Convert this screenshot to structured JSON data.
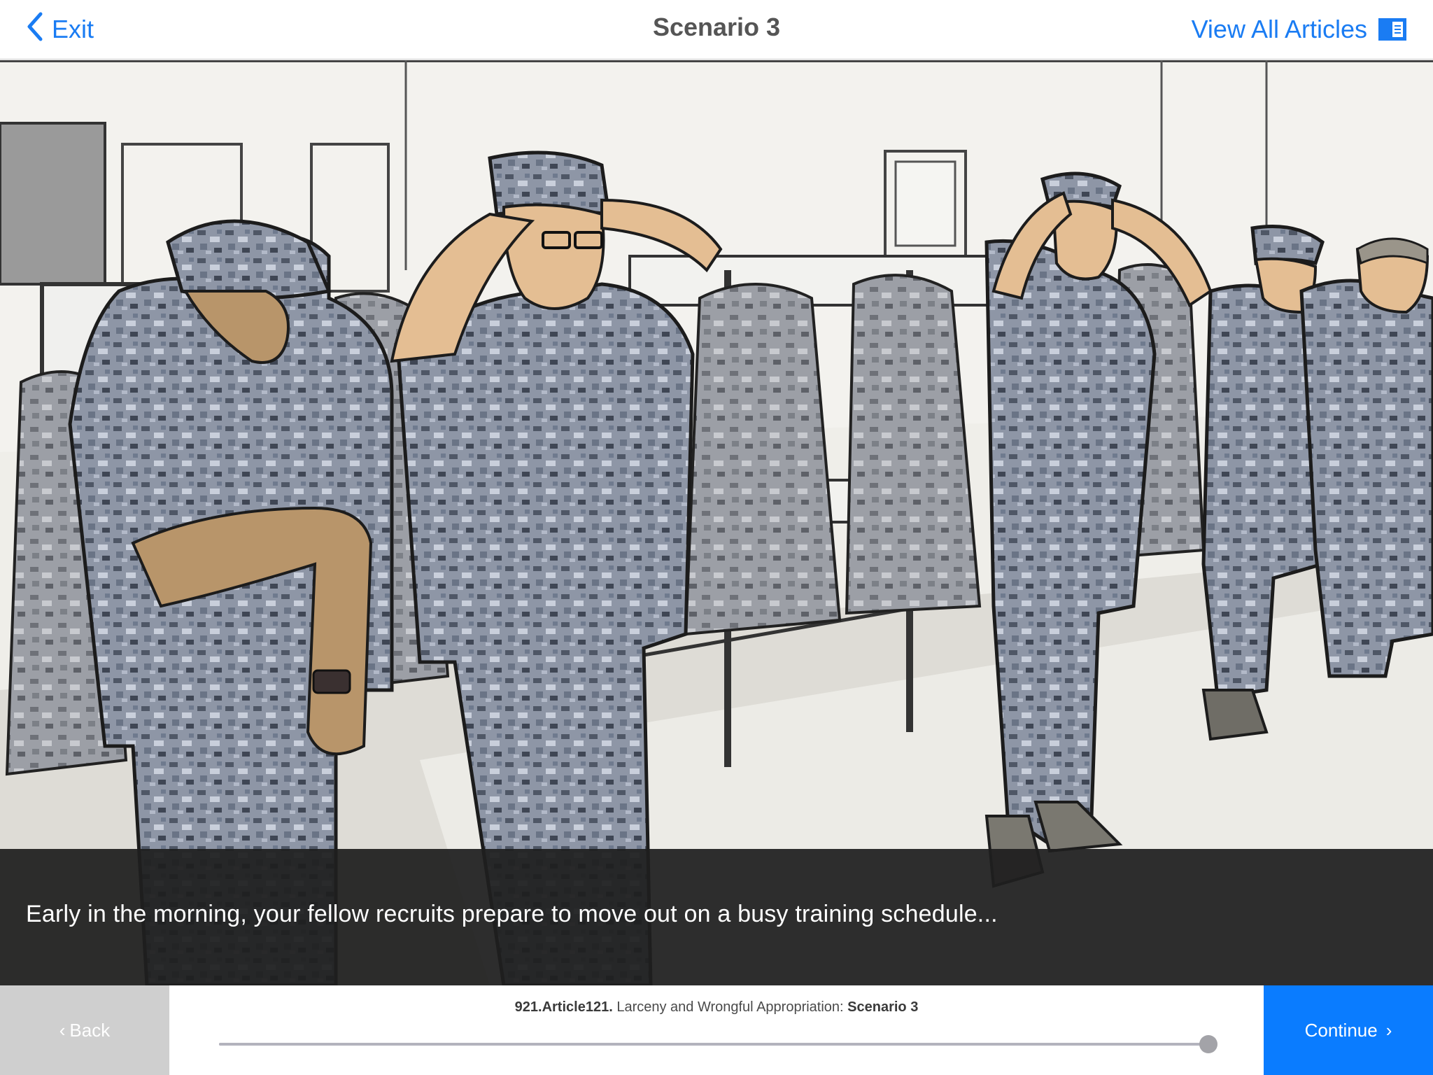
{
  "header": {
    "exit_label": "Exit",
    "title": "Scenario 3",
    "view_all_label": "View All Articles"
  },
  "scene": {
    "caption": "Early in the morning, your fellow recruits prepare to move out on a busy training schedule..."
  },
  "footer": {
    "back_label": "Back",
    "breadcrumb": {
      "code": "921.Article121.",
      "article": " Larceny and Wrongful Appropriation: ",
      "scenario": "Scenario 3"
    },
    "progress": 1.0,
    "continue_label": "Continue"
  },
  "colors": {
    "accent": "#1a7cf3",
    "continue_bg": "#0a7cff",
    "back_bg": "#cfcfcf"
  },
  "icons": {
    "exit": "chevron-left-icon",
    "view_all": "articles-list-icon",
    "back": "chevron-left-icon",
    "continue": "chevron-right-icon"
  }
}
